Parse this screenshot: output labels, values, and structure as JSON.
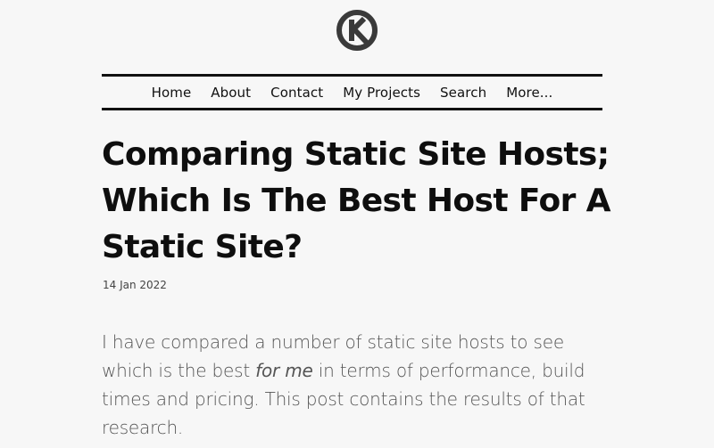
{
  "header": {
    "logo_icon": "k-circle-logo-icon",
    "nav": [
      {
        "label": "Home"
      },
      {
        "label": "About"
      },
      {
        "label": "Contact"
      },
      {
        "label": "My Projects"
      },
      {
        "label": "Search"
      },
      {
        "label": "More..."
      }
    ]
  },
  "article": {
    "title": "Comparing Static Site Hosts; Which Is The Best Host For A Static Site?",
    "date": "14 Jan 2022",
    "intro": {
      "part1": "I have compared a number of static site hosts to see which is the best ",
      "emphasis": "for me",
      "part2": " in terms of performance, build times and pricing. This post contains the results of that research."
    }
  },
  "colors": {
    "background": "#f7f7f7",
    "text": "#111111",
    "muted": "#555555"
  }
}
